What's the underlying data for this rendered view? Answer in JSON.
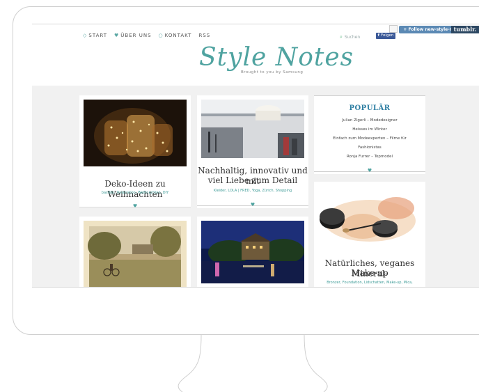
{
  "nav": {
    "start": "START",
    "ueber_uns": "ÜBER UNS",
    "kontakt": "KONTAKT",
    "rss": "RSS"
  },
  "search": {
    "label": "Suchen"
  },
  "social": {
    "facebook_follow": "Folgen",
    "tumblr_follow": "+ Follow new-style-notes",
    "tumblr_brand": "tumblr."
  },
  "brand": {
    "logo": "Style Notes",
    "tagline": "Brought to you by Samsung"
  },
  "posts": [
    {
      "title": "Deko-Ideen zu Weihnachten",
      "tags": "basteln, Dekoration, Weihnachten, DIY"
    },
    {
      "title_line1": "Nachhaltig, innovativ und mit",
      "title_line2": "viel Liebe zum Detail",
      "tags": "Kleider, LOLA | FRED, Yoga, Zürich, Shopping"
    },
    {
      "title_line1": "Natürliches, veganes Mineral-",
      "title_line2": "Make-up",
      "tags": "Bronzer, Foundation, Lidschatten, Make-up, Mica,"
    }
  ],
  "popular": {
    "title": "POPULÄR",
    "items": [
      "Julian Zigerli – Modedesigner",
      "Heisses im Winter",
      "Einfach zum Modeexperten – Filme für",
      "Fashionistas",
      "Ronja Furrer – Topmodel"
    ]
  },
  "icons": {
    "heart": "♥",
    "diamond": "◇"
  },
  "colors": {
    "accent": "#4fa3a0",
    "tumblr": "#5b89b4",
    "facebook": "#3b5998"
  }
}
